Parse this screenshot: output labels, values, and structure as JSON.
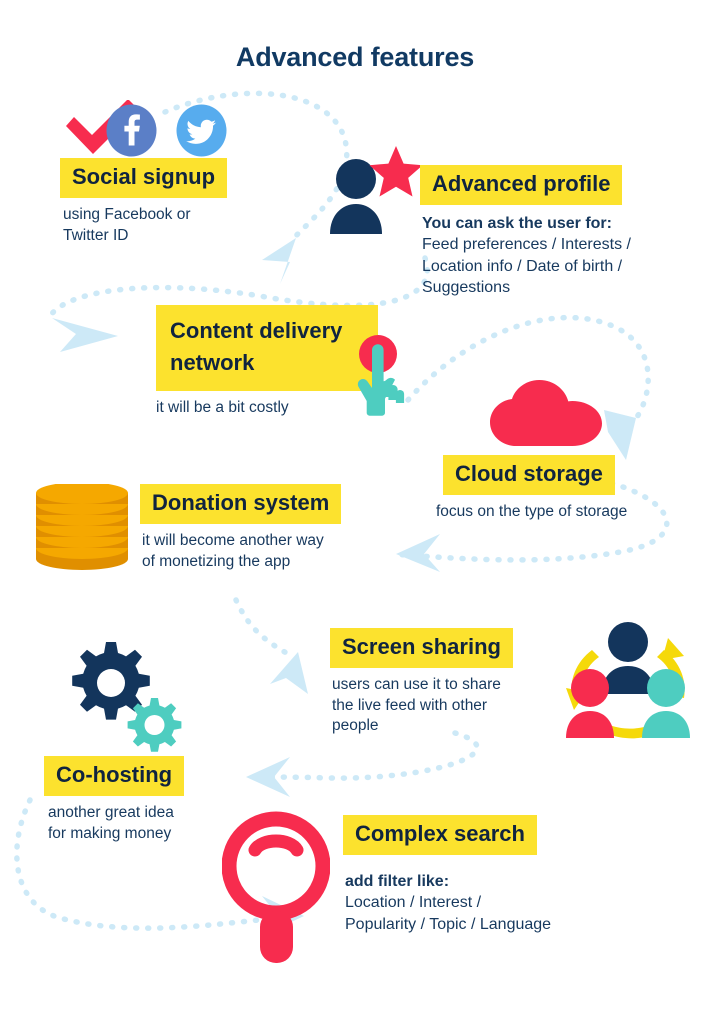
{
  "title": "Advanced features",
  "colors": {
    "navy": "#13355C",
    "yellow": "#FCE22E",
    "red": "#F72C4E",
    "teal": "#4ECDC0",
    "gold": "#F0A500",
    "sky": "#CDE9F7",
    "facebook_blue": "#5B7FC7",
    "twitter_blue": "#57ACEE",
    "text_navy": "#17395E"
  },
  "features": [
    {
      "id": "social-signup",
      "label": "Social signup",
      "desc": "using Facebook or\nTwitter ID",
      "icons": [
        "check-icon",
        "facebook-icon",
        "twitter-icon"
      ]
    },
    {
      "id": "advanced-profile",
      "label": "Advanced profile",
      "desc_lead": "You can ask the user for:",
      "desc": "Feed preferences / Interests /\nLocation info / Date of birth /\nSuggestions",
      "icons": [
        "user-icon",
        "star-icon"
      ]
    },
    {
      "id": "content-delivery-network",
      "label": "Content delivery\nnetwork",
      "desc": "it will be a bit costly",
      "icons": [
        "tap-hand-icon"
      ]
    },
    {
      "id": "cloud-storage",
      "label": "Cloud storage",
      "desc": "focus on the type of storage",
      "icons": [
        "cloud-icon"
      ]
    },
    {
      "id": "donation-system",
      "label": "Donation system",
      "desc": "it will become another way\nof monetizing the app",
      "icons": [
        "coin-stack-icon"
      ]
    },
    {
      "id": "screen-sharing",
      "label": "Screen sharing",
      "desc": "users can use it to share\nthe live feed with other\npeople",
      "icons": [
        "people-sharing-icon"
      ]
    },
    {
      "id": "co-hosting",
      "label": "Co-hosting",
      "desc": "another great idea\nfor making money",
      "icons": [
        "gears-icon"
      ]
    },
    {
      "id": "complex-search",
      "label": "Complex search",
      "desc_lead": "add filter like:",
      "desc": "Location / Interest /\nPopularity / Topic / Language",
      "icons": [
        "magnifier-icon"
      ]
    }
  ],
  "social_signup": {
    "label": "Social signup",
    "desc_line1": "using Facebook or",
    "desc_line2": "Twitter ID"
  },
  "advanced_profile": {
    "label": "Advanced profile",
    "lead": "You can ask the user for:",
    "line1": "Feed preferences / Interests /",
    "line2": "Location info / Date of birth /",
    "line3": "Suggestions"
  },
  "content_delivery": {
    "label_line1": "Content delivery",
    "label_line2": "network",
    "desc": "it will be a bit costly"
  },
  "cloud_storage": {
    "label": "Cloud storage",
    "desc": "focus on the type of storage"
  },
  "donation_system": {
    "label": "Donation system",
    "desc_line1": "it will become another way",
    "desc_line2": "of monetizing the app"
  },
  "screen_sharing": {
    "label": "Screen sharing",
    "desc_line1": "users can use it to share",
    "desc_line2": "the live feed with other",
    "desc_line3": "people"
  },
  "co_hosting": {
    "label": "Co-hosting",
    "desc_line1": "another great idea",
    "desc_line2": "for making money"
  },
  "complex_search": {
    "label": "Complex search",
    "lead": "add filter like:",
    "line1": "Location / Interest /",
    "line2": "Popularity / Topic / Language"
  }
}
